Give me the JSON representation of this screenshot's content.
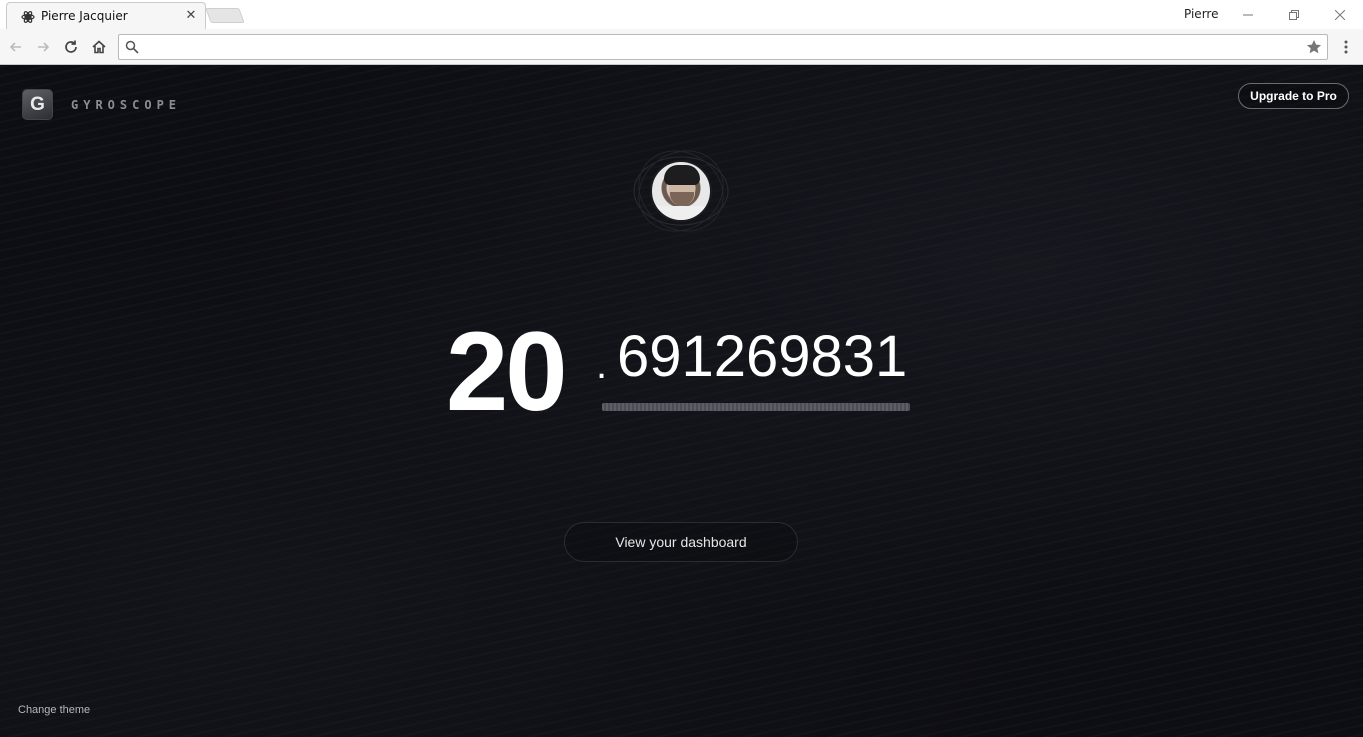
{
  "browser": {
    "tab": {
      "title": "Pierre Jacquier",
      "close_glyph": "✕"
    },
    "profile_name": "Pierre",
    "window_controls": [
      "minimize-icon",
      "restore-icon",
      "close-icon"
    ],
    "nav_icons": [
      "back-icon",
      "forward-icon",
      "reload-icon",
      "home-icon"
    ],
    "omnibox": {
      "value": "",
      "placeholder": ""
    }
  },
  "app": {
    "logo_letter": "G",
    "brand": "GYROSCOPE",
    "upgrade_label": "Upgrade to Pro",
    "age": {
      "integer": "20",
      "dot": ".",
      "decimal": "691269831",
      "progress_fraction": 1.0
    },
    "dashboard_label": "View your dashboard",
    "change_theme_label": "Change theme"
  },
  "colors": {
    "background": "#0d0e13",
    "text": "#ffffff",
    "muted": "#8c8d92"
  }
}
